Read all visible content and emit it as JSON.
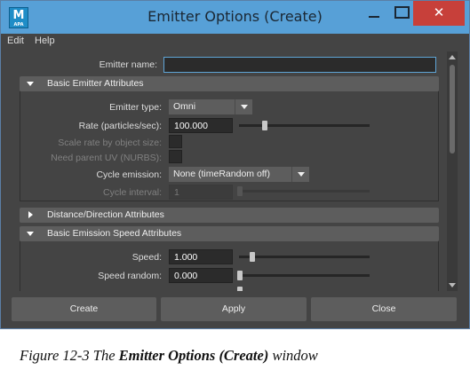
{
  "window": {
    "title": "Emitter Options (Create)",
    "icon_letter": "M",
    "icon_sub": "APA",
    "close_glyph": "✕"
  },
  "menu": [
    "Edit",
    "Help"
  ],
  "emitter_name": {
    "label": "Emitter name:",
    "value": ""
  },
  "sections": {
    "basic_emitter": "Basic Emitter Attributes",
    "distance_direction": "Distance/Direction Attributes",
    "basic_emission_speed": "Basic Emission Speed Attributes"
  },
  "fields": {
    "emitter_type": {
      "label": "Emitter type:",
      "value": "Omni"
    },
    "rate": {
      "label": "Rate (particles/sec):",
      "value": "100.000",
      "slider_fraction": 0.25
    },
    "scale_rate": {
      "label": "Scale rate by object size:",
      "enabled": false
    },
    "need_parent_uv": {
      "label": "Need parent UV (NURBS):",
      "enabled": false
    },
    "cycle_emission": {
      "label": "Cycle emission:",
      "value": "None (timeRandom off)"
    },
    "cycle_interval": {
      "label": "Cycle interval:",
      "value": "1",
      "enabled": false
    },
    "speed": {
      "label": "Speed:",
      "value": "1.000",
      "slider_fraction": 0.1
    },
    "speed_random": {
      "label": "Speed random:",
      "value": "0.000",
      "slider_fraction": 0.0
    }
  },
  "buttons": {
    "create": "Create",
    "apply": "Apply",
    "close": "Close"
  },
  "caption": {
    "prefix": "Figure 12-3  The ",
    "bold": "Emitter Options (Create)",
    "suffix": " window"
  },
  "colors": {
    "titlebar": "#57a0d7",
    "panel": "#444444",
    "close_button": "#c7403a",
    "focus_border": "#5fa5d6"
  },
  "icons": {
    "section_open": "triangle-down-icon",
    "section_closed": "triangle-right-icon",
    "dropdown": "chevron-down-icon"
  }
}
